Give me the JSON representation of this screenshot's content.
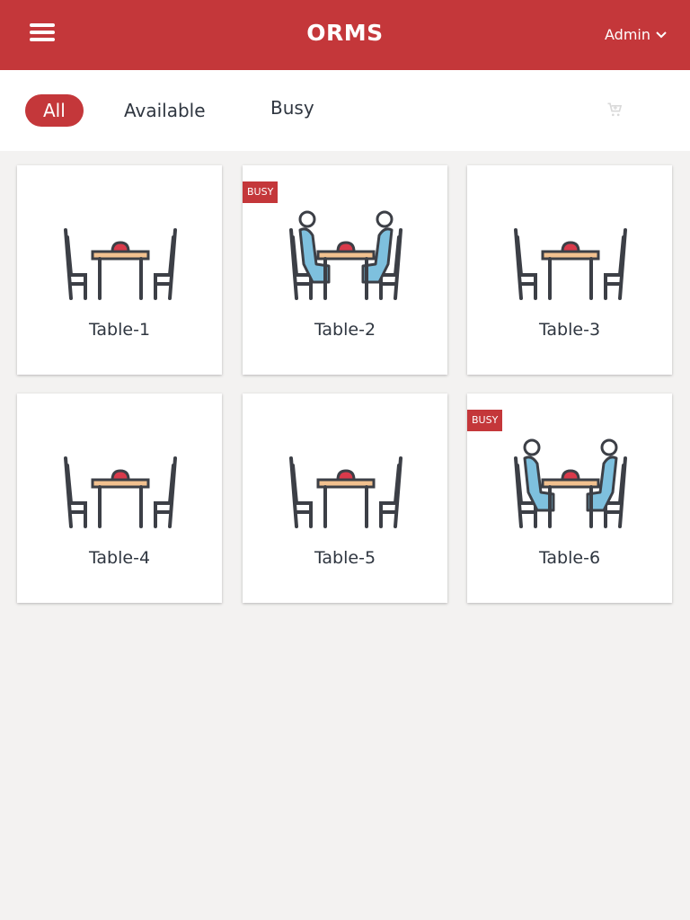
{
  "header": {
    "title": "ORMS",
    "user_label": "Admin",
    "menu_icon": "hamburger-icon",
    "dropdown_icon": "chevron-down-icon"
  },
  "filters": {
    "tabs": [
      {
        "label": "All",
        "active": true
      },
      {
        "label": "Available",
        "active": false
      },
      {
        "label": "Busy",
        "active": false
      }
    ],
    "cart_icon": "cart-icon"
  },
  "tables": [
    {
      "label": "Table-1",
      "status": "available",
      "badge": ""
    },
    {
      "label": "Table-2",
      "status": "busy",
      "badge": "BUSY"
    },
    {
      "label": "Table-3",
      "status": "available",
      "badge": ""
    },
    {
      "label": "Table-4",
      "status": "available",
      "badge": ""
    },
    {
      "label": "Table-5",
      "status": "available",
      "badge": ""
    },
    {
      "label": "Table-6",
      "status": "busy",
      "badge": "BUSY"
    }
  ],
  "colors": {
    "brand": "#c4373a",
    "background": "#f3f2f1",
    "person": "#7ec0de",
    "tabletop": "#f2c18f",
    "dish": "#d93a4b",
    "stroke": "#3c3f46"
  }
}
